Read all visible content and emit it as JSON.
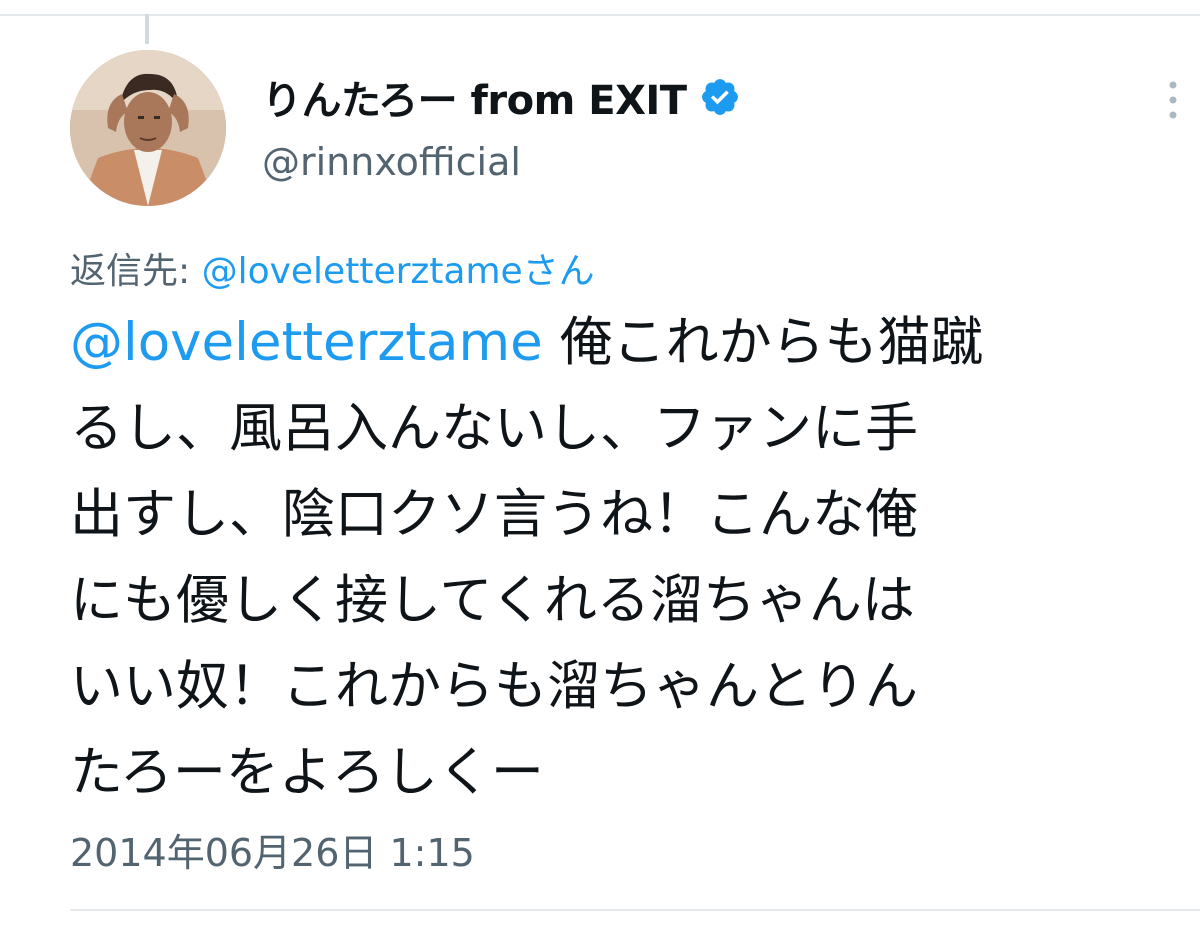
{
  "author": {
    "display_name": "りんたろー from EXIT",
    "handle": "@rinnxofficial",
    "verified": true
  },
  "reply_context": {
    "prefix": "返信先: ",
    "target": "@loveletterztameさん"
  },
  "tweet": {
    "mention": "@loveletterztame",
    "lines": [
      " 俺これからも猫蹴",
      "るし、風呂入んないし、ファンに手",
      "出すし、陰口クソ言うね！こんな俺",
      "にも優しく接してくれる溜ちゃんは",
      "いい奴！これからも溜ちゃんとりん",
      "たろーをよろしくー"
    ]
  },
  "timestamp": "2014年06月26日 1:15",
  "colors": {
    "accent": "#1d9bf0",
    "secondary_text": "#536471",
    "primary_text": "#0f1419",
    "divider": "#e6e9ec"
  },
  "icons": {
    "verified": "verified-badge-icon",
    "more": "more-vertical-icon"
  }
}
